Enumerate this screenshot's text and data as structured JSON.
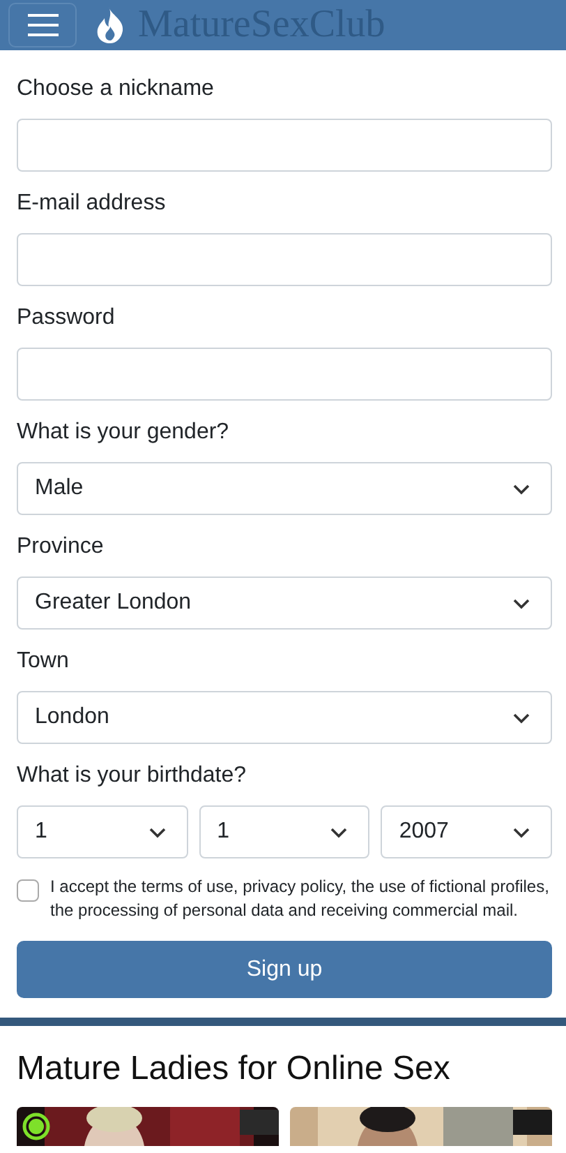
{
  "header": {
    "logo": "MatureSexClub"
  },
  "form": {
    "fields": [
      {
        "kind": "text",
        "label": "Choose a nickname"
      },
      {
        "kind": "text",
        "label": "E-mail address"
      },
      {
        "kind": "password",
        "label": "Password"
      },
      {
        "kind": "select",
        "label": "What is your gender?",
        "value": "Male"
      },
      {
        "kind": "select",
        "label": "Province",
        "value": "Greater London"
      },
      {
        "kind": "select",
        "label": "Town",
        "value": "London"
      }
    ],
    "birthdate": {
      "label": "What is your birthdate?",
      "values": [
        "1",
        "1",
        "2007"
      ]
    },
    "terms": {
      "checked": false,
      "text": "I accept the terms of use, privacy policy, the use of fictional profiles, the processing of personal data and receiving commercial mail."
    },
    "submit": "Sign up"
  },
  "section": {
    "title": "Mature Ladies for Online Sex",
    "profiles": [
      {
        "kind": "picture",
        "online": true
      },
      {
        "kind": "picture",
        "online": false
      }
    ]
  }
}
